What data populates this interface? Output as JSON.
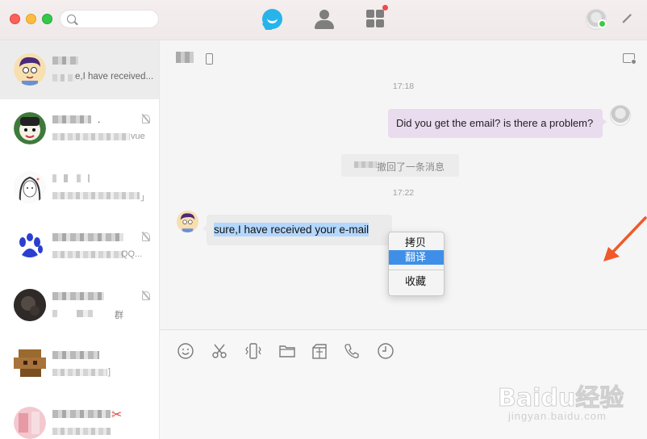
{
  "search": {
    "placeholder": ""
  },
  "conversations": [
    {
      "preview": "e,I have received...",
      "active": true
    },
    {
      "preview": "vue",
      "active": false
    },
    {
      "preview": "",
      "active": false
    },
    {
      "preview": "QQ...",
      "active": false
    },
    {
      "preview": "群",
      "active": false
    },
    {
      "preview": "]",
      "active": false
    },
    {
      "preview": "",
      "active": false
    }
  ],
  "chat": {
    "messages": [
      {
        "time": "17:18"
      },
      {
        "direction": "out",
        "text": "Did you get the email? is there a problem?"
      },
      {
        "system": "撤回了一条消息"
      },
      {
        "time": "17:22"
      },
      {
        "direction": "in",
        "text": "sure,I have received your e-mail"
      }
    ]
  },
  "context_menu": {
    "items": [
      {
        "label": "拷贝",
        "highlighted": false
      },
      {
        "label": "翻译",
        "highlighted": true
      },
      {
        "label": "收藏",
        "highlighted": false
      }
    ]
  },
  "toolbar": {
    "icons": [
      "emoji-icon",
      "scissors-icon",
      "shake-icon",
      "folder-icon",
      "gift-icon",
      "phone-icon",
      "history-icon"
    ]
  },
  "watermark": {
    "brand": "Baidu经验",
    "url": "jingyan.baidu.com"
  },
  "colors": {
    "accent": "#27b4ea",
    "outgoing_bubble": "#e9dcef",
    "incoming_bubble": "#ebebeb",
    "selection": "#b3d7fd",
    "menu_highlight": "#3f8fe8",
    "arrow": "#f05a2a"
  }
}
